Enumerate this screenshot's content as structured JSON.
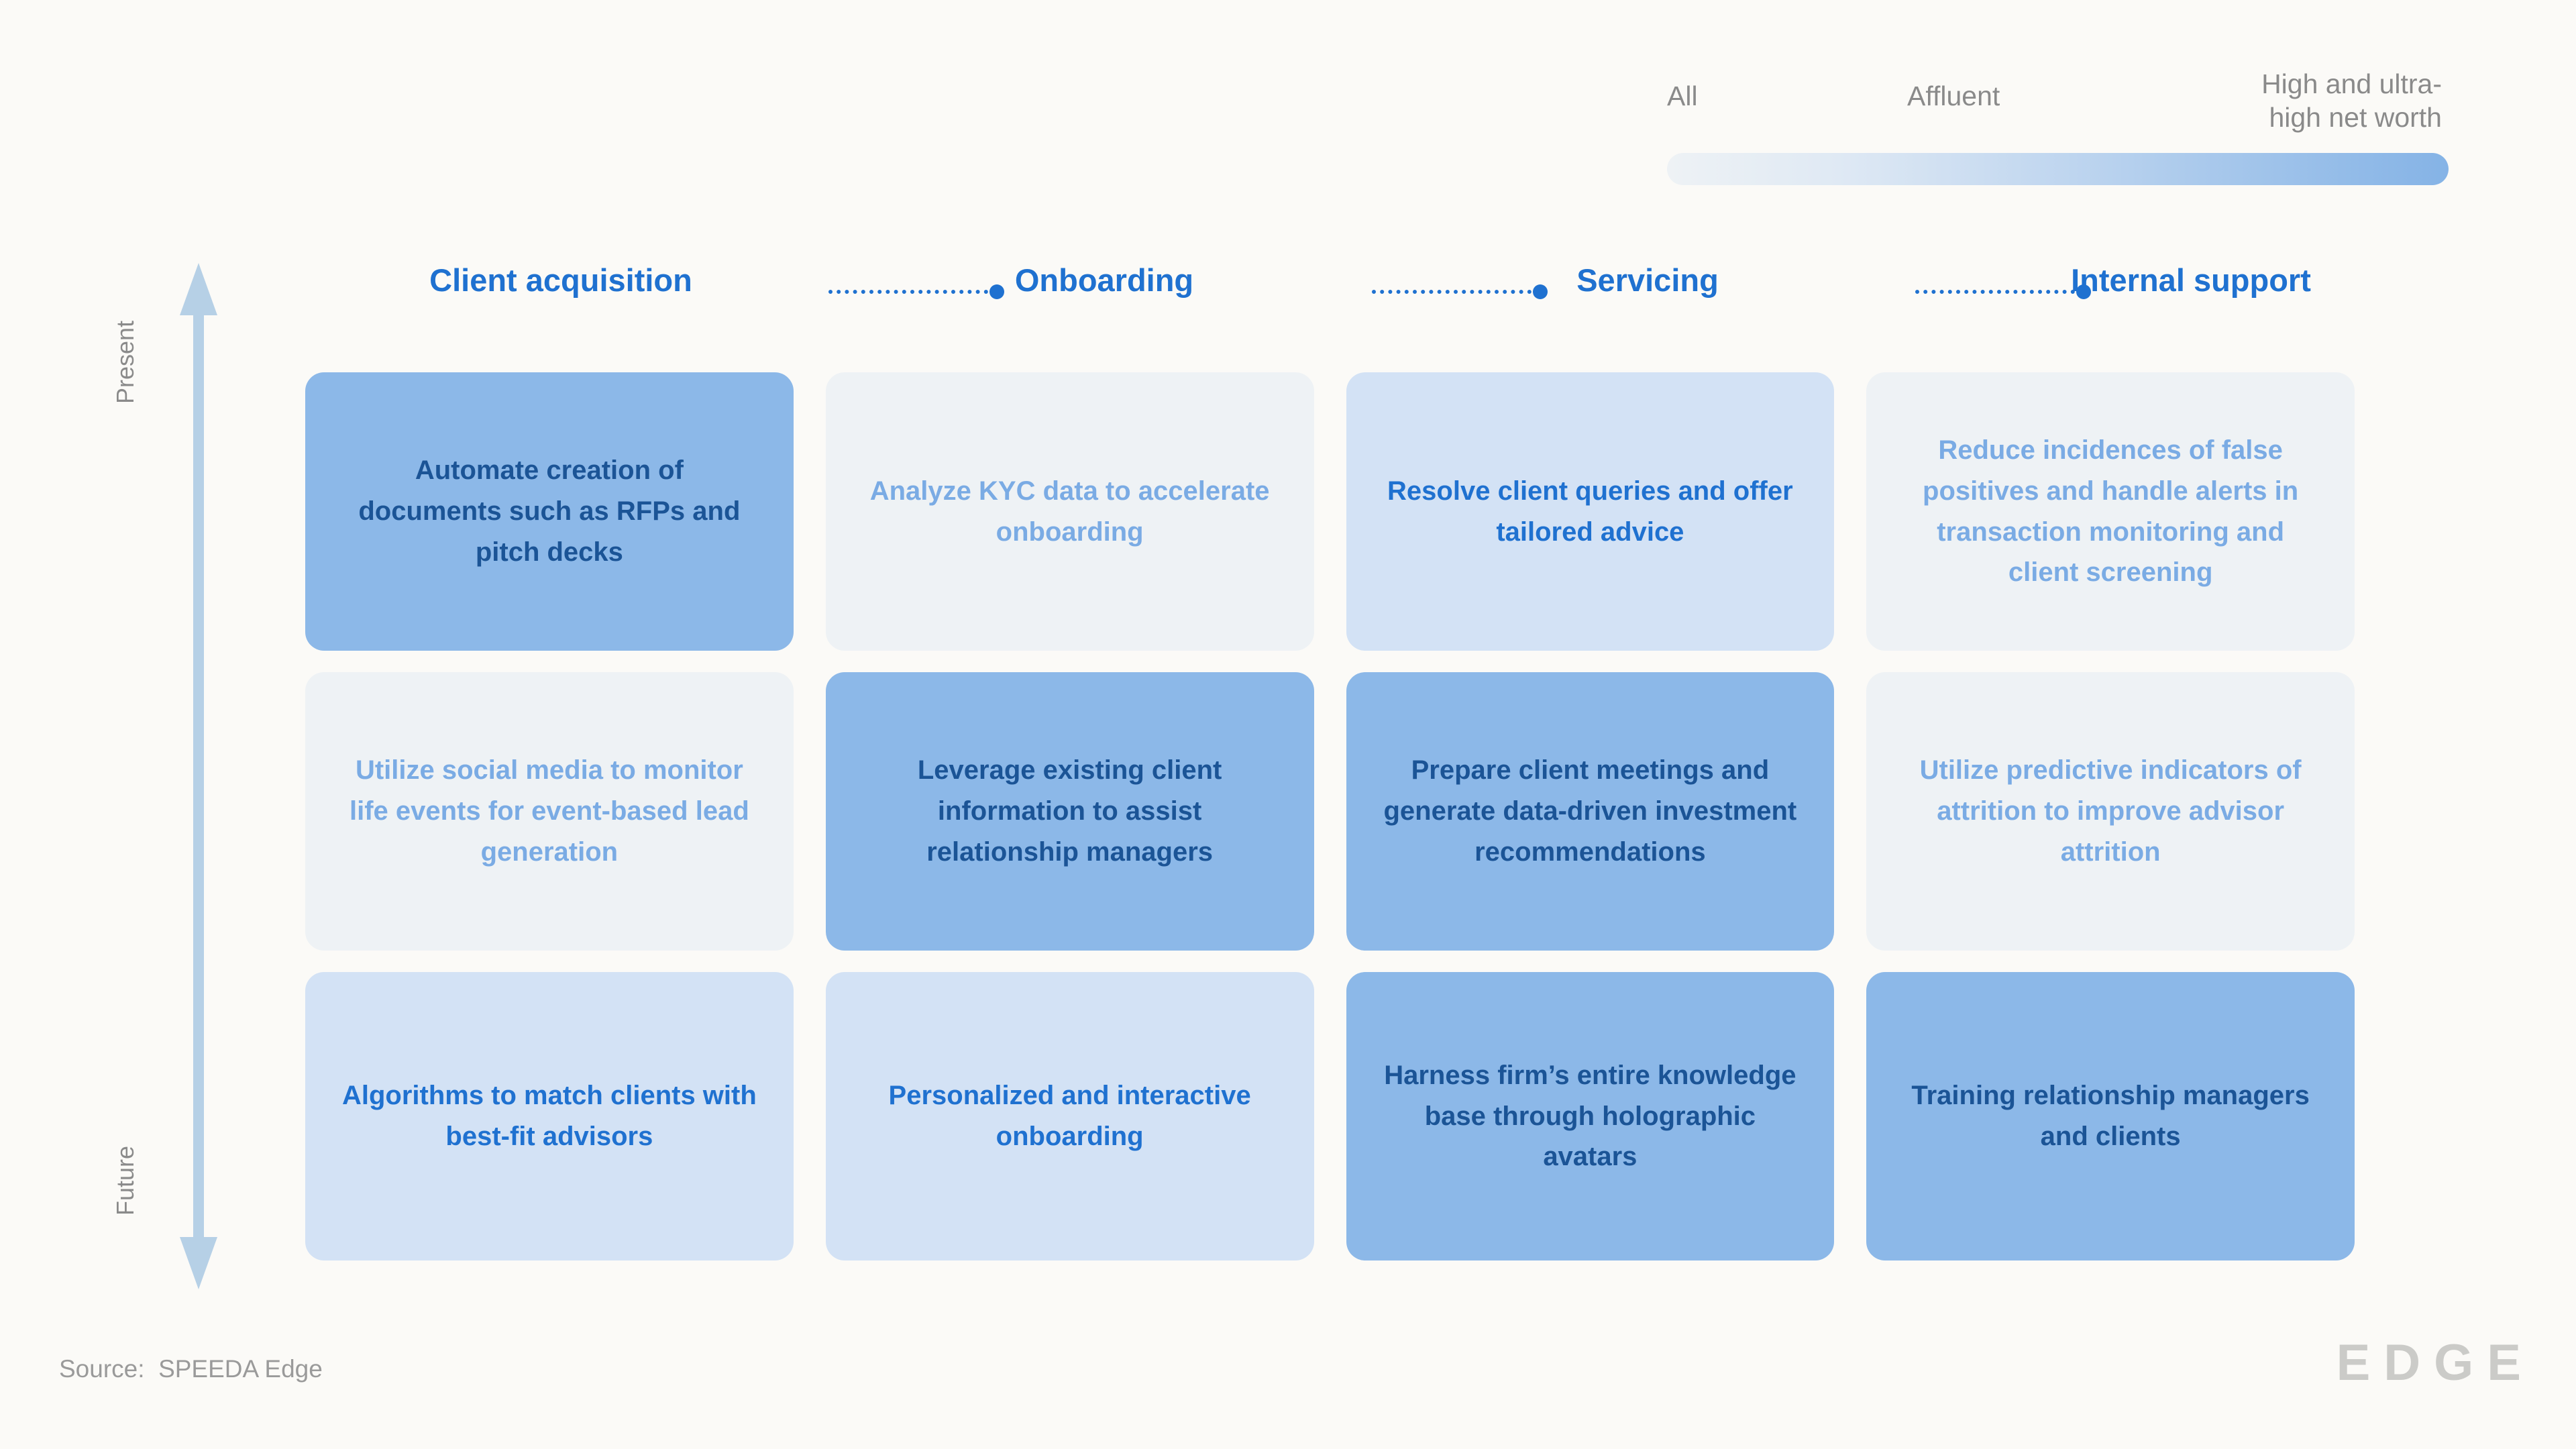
{
  "legend": {
    "labels": [
      {
        "id": "all",
        "text": "All"
      },
      {
        "id": "affluent",
        "text": "Affluent"
      },
      {
        "id": "hnw",
        "text": "High and ultra-\nhigh net worth"
      }
    ],
    "gradient_from": "#eef2f5",
    "gradient_to": "#85b3e6"
  },
  "axis": {
    "top_label": "Present",
    "bottom_label": "Future",
    "color": "#b6d0e6"
  },
  "columns": [
    {
      "label": "Client acquisition"
    },
    {
      "label": "Onboarding"
    },
    {
      "label": "Servicing"
    },
    {
      "label": "Internal support"
    }
  ],
  "connector": {
    "color": "#1f71d0"
  },
  "cards": [
    [
      {
        "text": "Automate creation of documents such as RFPs and pitch decks",
        "level": 3
      },
      {
        "text": "Analyze KYC data to accelerate onboarding",
        "level": 1
      },
      {
        "text": "Resolve client queries and offer tailored advice",
        "level": 2
      },
      {
        "text": "Reduce incidences of false positives and handle alerts in transaction monitoring and client screening",
        "level": 1
      }
    ],
    [
      {
        "text": "Utilize social media to monitor life events for event-based lead generation",
        "level": 1
      },
      {
        "text": "Leverage existing client information to assist relationship managers",
        "level": 3
      },
      {
        "text": "Prepare client meetings and generate data-driven investment recommendations",
        "level": 3
      },
      {
        "text": "Utilize predictive indicators of attrition to improve advisor attrition",
        "level": 1
      }
    ],
    [
      {
        "text": "Algorithms to match clients with best-fit advisors",
        "level": 2
      },
      {
        "text": "Personalized and interactive onboarding",
        "level": 2
      },
      {
        "text": "Harness firm’s entire knowledge base through holographic avatars",
        "level": 3
      },
      {
        "text": "Training relationship managers and clients",
        "level": 3
      }
    ]
  ],
  "footer": {
    "source": "Source:  SPEEDA Edge",
    "logo": "EDGE"
  }
}
